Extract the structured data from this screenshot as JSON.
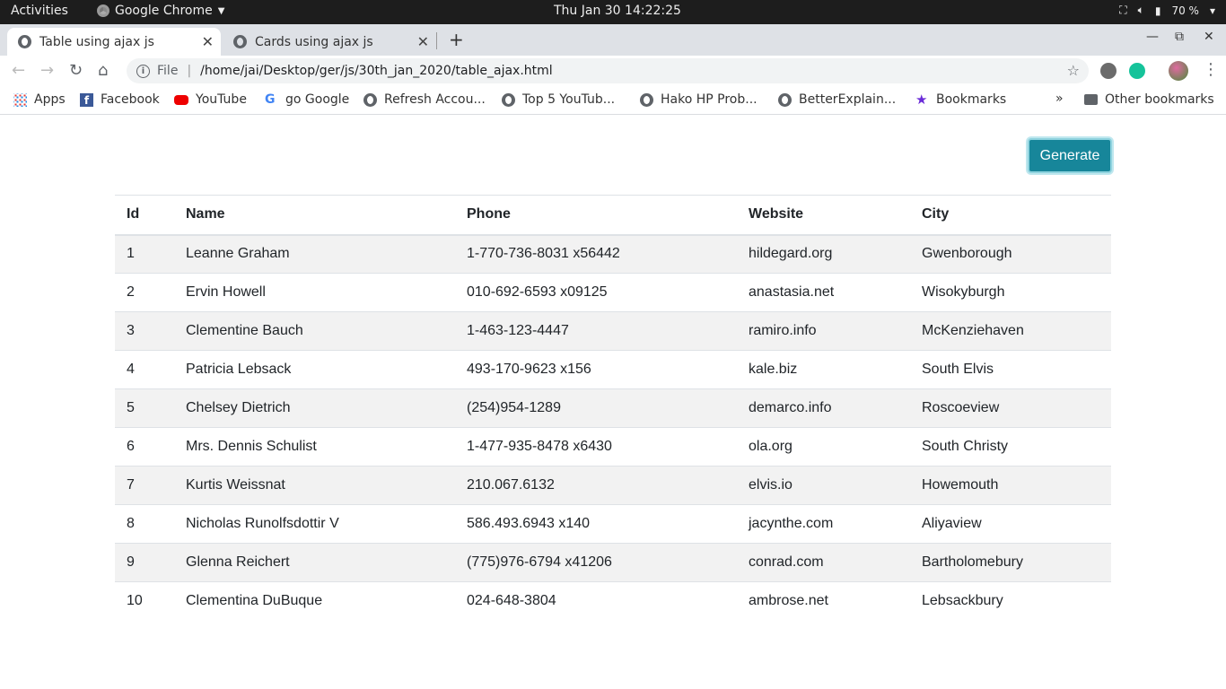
{
  "system_bar": {
    "activities": "Activities",
    "app_name": "Google Chrome",
    "clock": "Thu Jan 30  14:22:25",
    "battery": "70 %"
  },
  "tabs": [
    {
      "title": "Table using ajax js",
      "active": true
    },
    {
      "title": "Cards using ajax js",
      "active": false
    }
  ],
  "omnibox": {
    "scheme": "File",
    "url": "/home/jai/Desktop/ger/js/30th_jan_2020/table_ajax.html"
  },
  "bookmarks": [
    {
      "label": "Apps",
      "icon": "apps-grid-icon"
    },
    {
      "label": "Facebook",
      "icon": "facebook-icon"
    },
    {
      "label": "YouTube",
      "icon": "youtube-icon"
    },
    {
      "label": "go Google",
      "icon": "google-icon"
    },
    {
      "label": "Refresh Accou...",
      "icon": "globe-icon"
    },
    {
      "label": "Top 5 YouTub...",
      "icon": "globe-icon"
    },
    {
      "label": "Hako HP Prob...",
      "icon": "globe-icon"
    },
    {
      "label": "BetterExplain...",
      "icon": "globe-icon"
    },
    {
      "label": "Bookmarks",
      "icon": "star-icon"
    },
    {
      "label": "Other bookmarks",
      "icon": "folder-icon"
    }
  ],
  "page": {
    "generate_label": "Generate",
    "columns": [
      "Id",
      "Name",
      "Phone",
      "Website",
      "City"
    ],
    "rows": [
      [
        "1",
        "Leanne Graham",
        "1-770-736-8031 x56442",
        "hildegard.org",
        "Gwenborough"
      ],
      [
        "2",
        "Ervin Howell",
        "010-692-6593 x09125",
        "anastasia.net",
        "Wisokyburgh"
      ],
      [
        "3",
        "Clementine Bauch",
        "1-463-123-4447",
        "ramiro.info",
        "McKenziehaven"
      ],
      [
        "4",
        "Patricia Lebsack",
        "493-170-9623 x156",
        "kale.biz",
        "South Elvis"
      ],
      [
        "5",
        "Chelsey Dietrich",
        "(254)954-1289",
        "demarco.info",
        "Roscoeview"
      ],
      [
        "6",
        "Mrs. Dennis Schulist",
        "1-477-935-8478 x6430",
        "ola.org",
        "South Christy"
      ],
      [
        "7",
        "Kurtis Weissnat",
        "210.067.6132",
        "elvis.io",
        "Howemouth"
      ],
      [
        "8",
        "Nicholas Runolfsdottir V",
        "586.493.6943 x140",
        "jacynthe.com",
        "Aliyaview"
      ],
      [
        "9",
        "Glenna Reichert",
        "(775)976-6794 x41206",
        "conrad.com",
        "Bartholomebury"
      ],
      [
        "10",
        "Clementina DuBuque",
        "024-648-3804",
        "ambrose.net",
        "Lebsackbury"
      ]
    ]
  },
  "colors": {
    "button": "#17869a",
    "stripe": "#f2f2f2",
    "topbar": "#1d1d1d",
    "tabstrip": "#dee1e6"
  }
}
